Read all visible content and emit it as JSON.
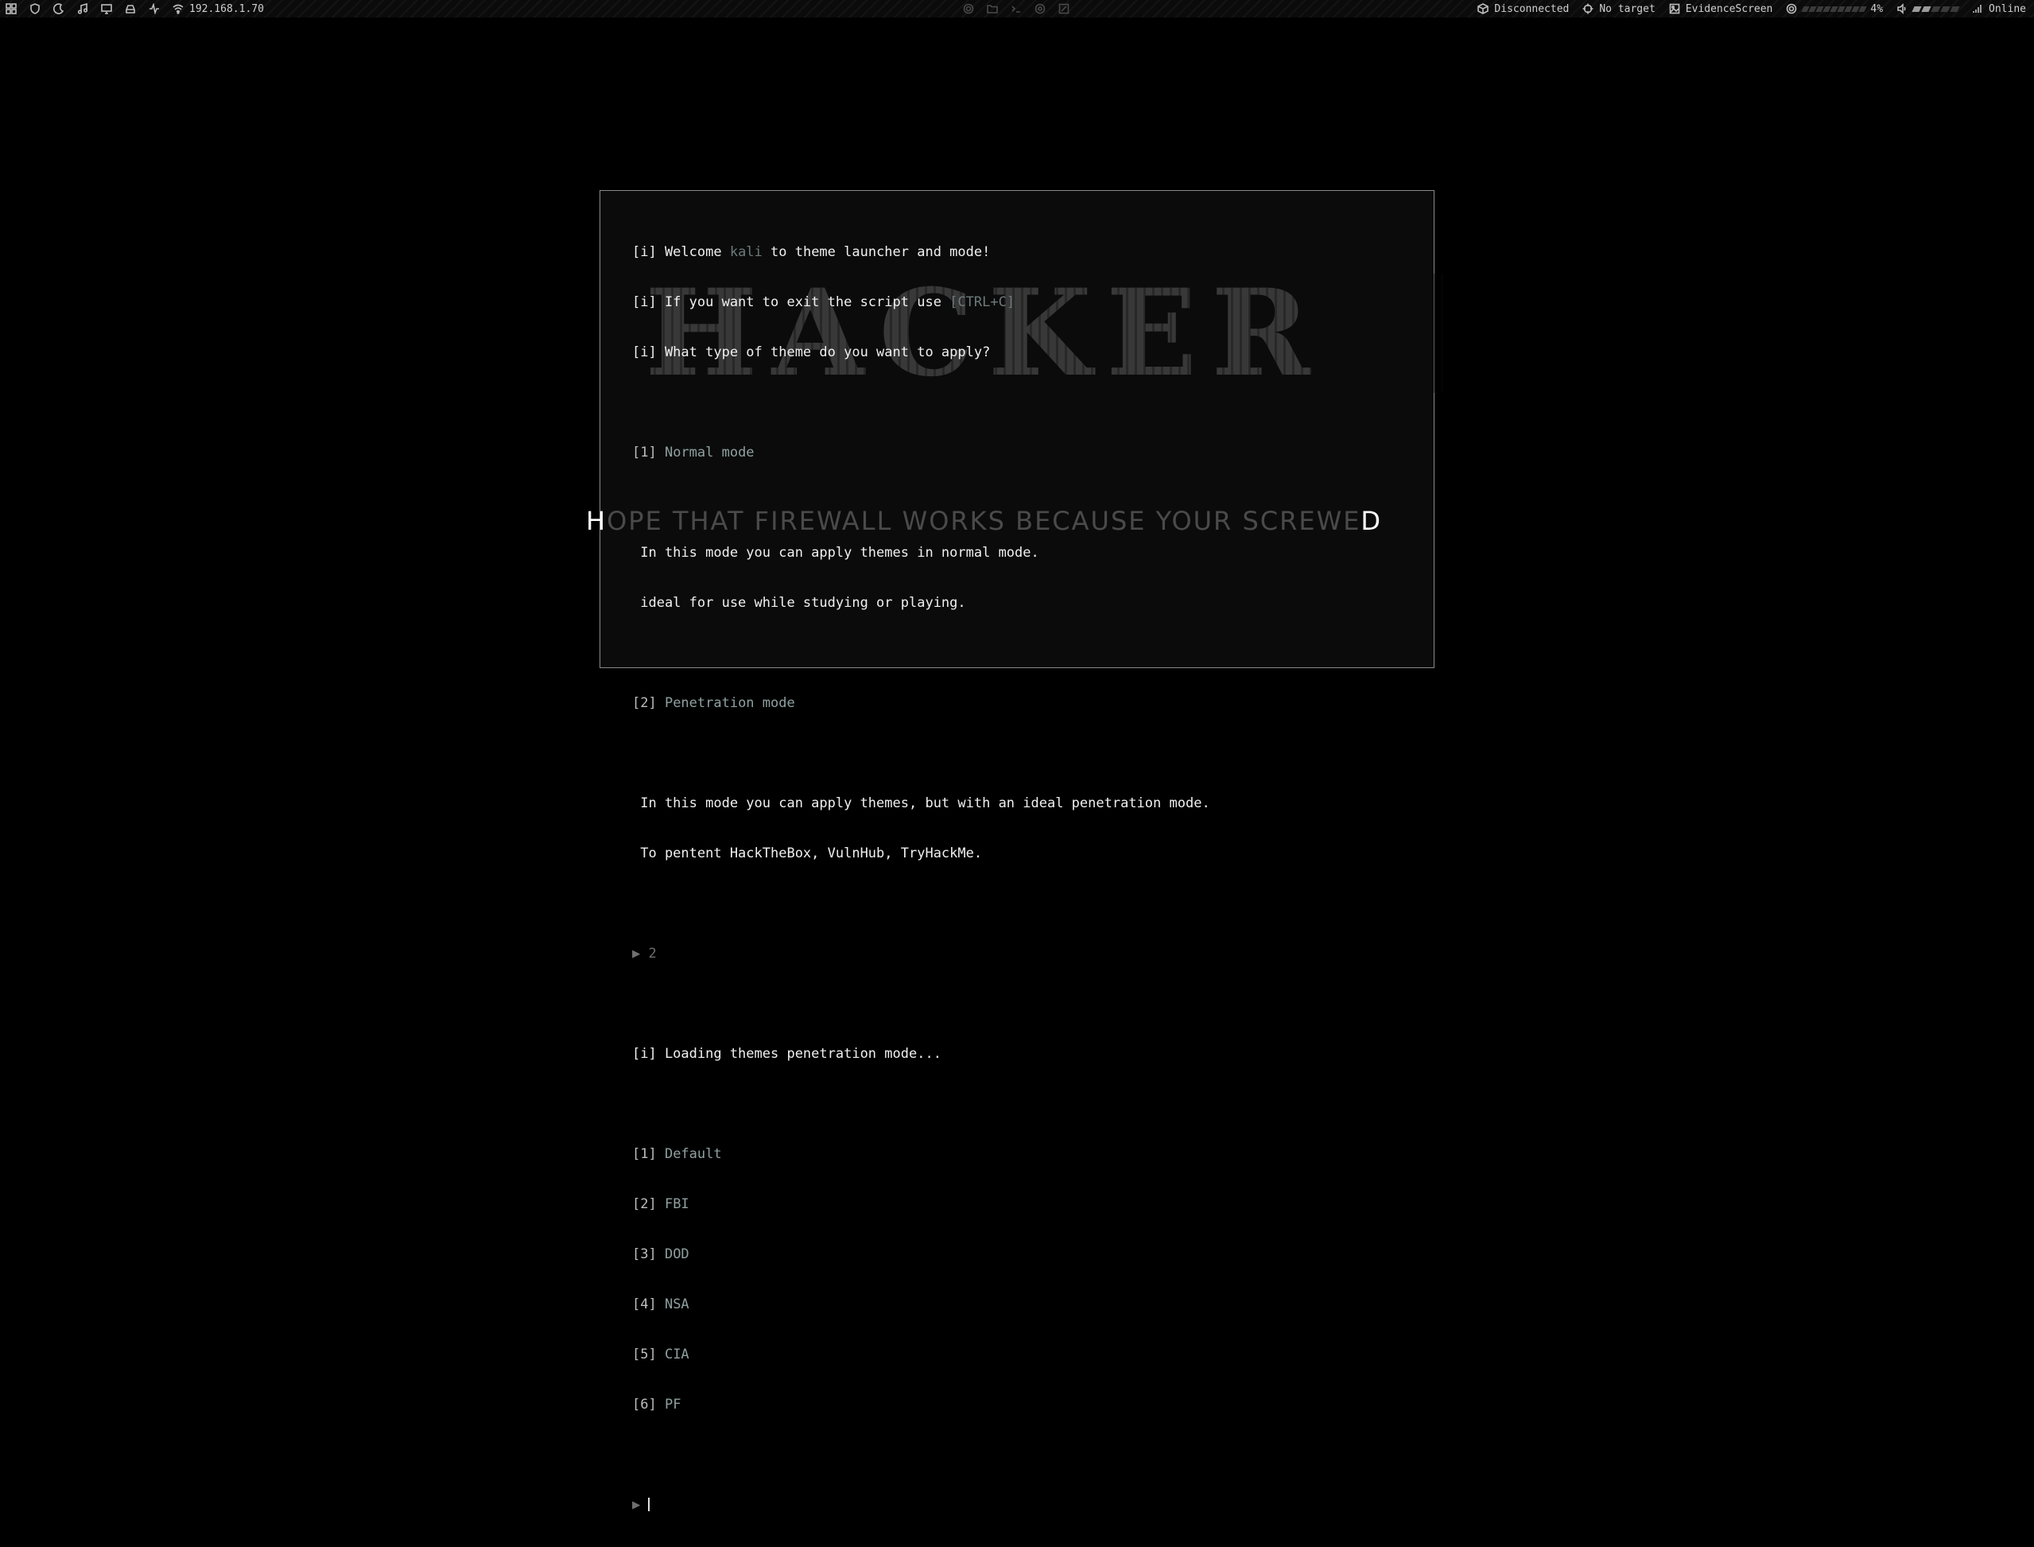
{
  "topbar": {
    "ip": "192.168.1.70",
    "vpn_status": "Disconnected",
    "target": "No target",
    "evidence": "EvidenceScreen",
    "cpu": "4%",
    "network": "Online",
    "volume_level": 0.4,
    "icons_left": [
      "grid-icon",
      "shield-icon",
      "moon-icon",
      "music-icon",
      "monitor-icon",
      "drive-icon",
      "activity-icon",
      "wifi-icon"
    ],
    "icons_center": [
      "settings-icon",
      "folder-icon",
      "terminal-icon",
      "browser-icon",
      "edit-icon"
    ]
  },
  "terminal": {
    "welcome_prefix": "[i] Welcome ",
    "user": "kali",
    "welcome_suffix": " to theme launcher and mode!",
    "exit_prefix": "[i] If you want to exit the script use ",
    "exit_key": "[CTRL+C]",
    "question": "[i] What type of theme do you want to apply?",
    "mode1_num": "[1] ",
    "mode1_name": "Normal mode",
    "mode1_desc1": " In this mode you can apply themes in normal mode.",
    "mode1_desc2": " ideal for use while studying or playing.",
    "mode2_num": "[2] ",
    "mode2_name": "Penetration mode",
    "mode2_desc1": " In this mode you can apply themes, but with an ideal penetration mode.",
    "mode2_desc2": " To pentent HackTheBox, VulnHub, TryHackMe.",
    "prompt_symbol": "▶ ",
    "input1": "2",
    "loading": "[i] Loading themes penetration mode...",
    "themes": [
      {
        "num": "[1] ",
        "name": "Default"
      },
      {
        "num": "[2] ",
        "name": "FBI"
      },
      {
        "num": "[3] ",
        "name": "DOD"
      },
      {
        "num": "[4] ",
        "name": "NSA"
      },
      {
        "num": "[5] ",
        "name": "CIA"
      },
      {
        "num": "[6] ",
        "name": "PF"
      }
    ]
  },
  "wallpaper": {
    "title": "HACKER",
    "slogan_first": "H",
    "slogan_mid": "OPE THAT FIREWALL WORKS BECAUSE YOUR SCREWE",
    "slogan_last": "D"
  },
  "colors": {
    "background": "#000000",
    "terminal_border": "#8a8a8a",
    "accent": "#6d7a7a"
  }
}
